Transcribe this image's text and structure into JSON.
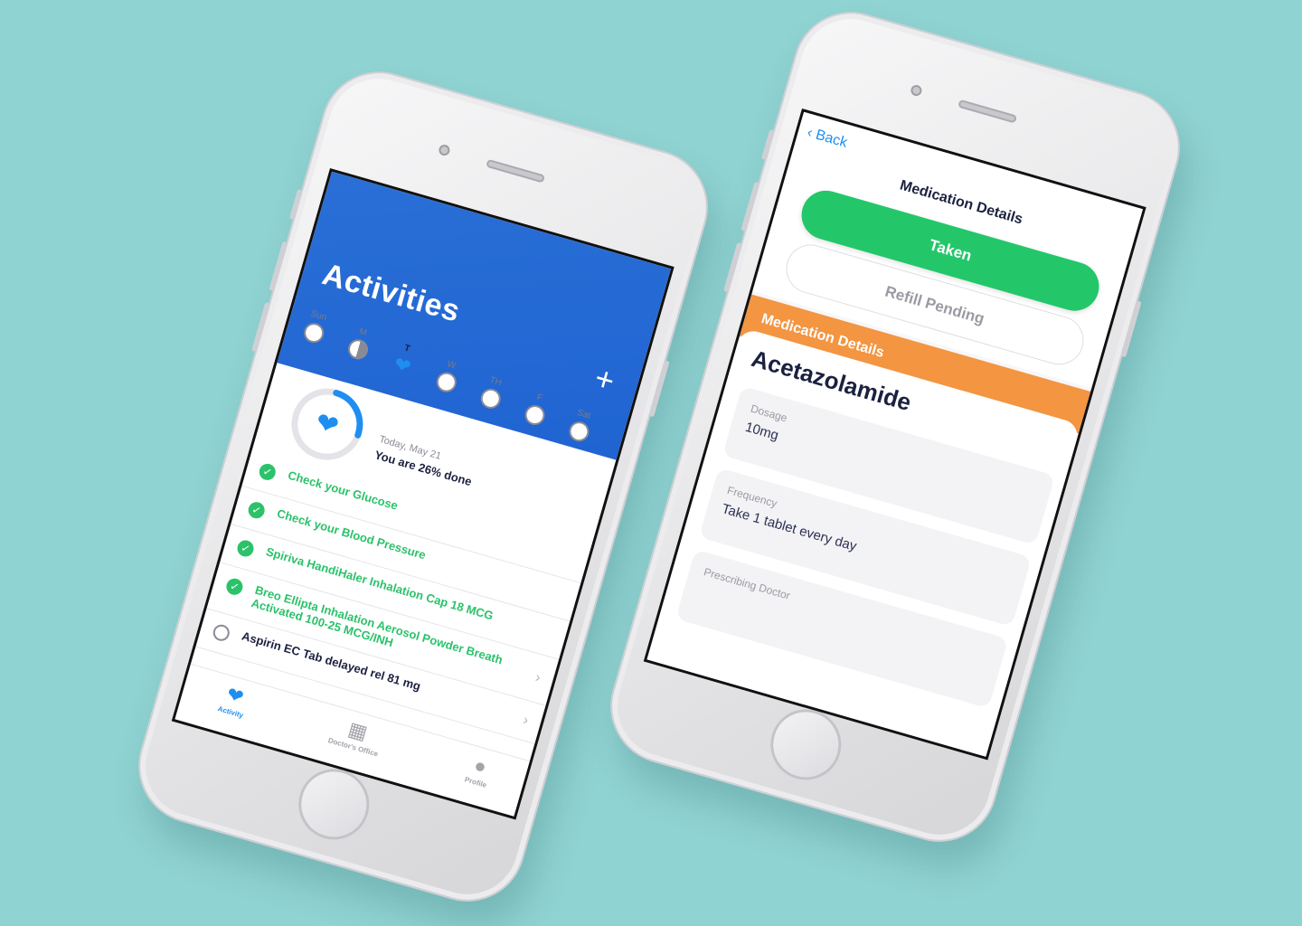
{
  "activities": {
    "title": "Activities",
    "plus_label": "+",
    "week": [
      {
        "label": "Sun",
        "state": "empty"
      },
      {
        "label": "M",
        "state": "half"
      },
      {
        "label": "T",
        "state": "heart"
      },
      {
        "label": "W",
        "state": "empty"
      },
      {
        "label": "TH",
        "state": "empty"
      },
      {
        "label": "F",
        "state": "empty"
      },
      {
        "label": "Sat",
        "state": "empty"
      }
    ],
    "today_label": "Today, May 21",
    "progress_text": "You are 26% done",
    "progress_fraction": 0.26,
    "items": [
      {
        "text": "Check your Glucose",
        "done": true
      },
      {
        "text": "Check your Blood Pressure",
        "done": true
      },
      {
        "text": "Spiriva HandiHaler Inhalation Cap 18 MCG",
        "done": true
      },
      {
        "text": "Breo Ellipta Inhalation Aerosol Powder Breath Activated 100-25 MCG/INH",
        "done": true
      },
      {
        "text": "Aspirin EC Tab delayed rel 81 mg",
        "done": false
      }
    ],
    "tabs": [
      {
        "label": "Activity",
        "icon": "heart-icon",
        "active": true
      },
      {
        "label": "Doctor's Office",
        "icon": "hospital-icon",
        "active": false
      },
      {
        "label": "Profile",
        "icon": "person-icon",
        "active": false
      }
    ]
  },
  "medication": {
    "back_label": "Back",
    "nav_title": "Medication Details",
    "taken_label": "Taken",
    "refill_label": "Refill Pending",
    "banner_label": "Medication Details",
    "name": "Acetazolamide",
    "fields": {
      "dosage_label": "Dosage",
      "dosage_value": "10mg",
      "frequency_label": "Frequency",
      "frequency_value": "Take 1 tablet every day",
      "doctor_label": "Prescribing Doctor",
      "doctor_value": ""
    }
  },
  "colors": {
    "background": "#8fd3d2",
    "header_blue": "#2a6fd6",
    "done_green": "#2bc26a",
    "taken_green": "#23c76a",
    "banner_orange": "#f39541",
    "accent_blue": "#1f8ef1"
  }
}
